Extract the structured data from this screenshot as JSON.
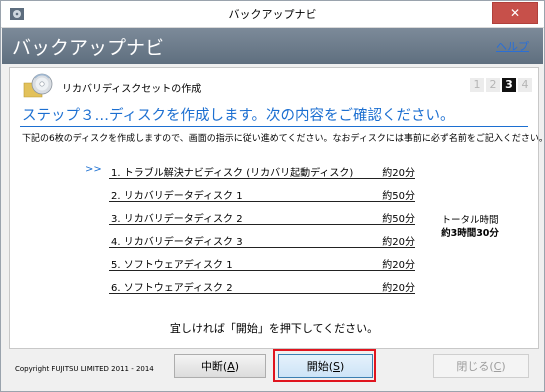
{
  "window": {
    "title": "バックアップナビ",
    "close_glyph": "✕"
  },
  "header": {
    "title": "バックアップナビ",
    "help_link": "ヘルプ"
  },
  "panel": {
    "section_label": "リカバリディスクセットの作成",
    "steps": [
      "1",
      "2",
      "3",
      "4"
    ],
    "current_step": 3,
    "heading": "ステップ３…ディスクを作成します。次の内容をご確認ください。",
    "instruction": "下記の6枚のディスクを作成しますので、画面の指示に従い進めてください。なおディスクには事前に必ず名前をご記入ください。",
    "current_marker": ">>",
    "discs": [
      {
        "name": "1. トラブル解決ナビディスク (リカバリ起動ディスク)",
        "time": "約20分"
      },
      {
        "name": "2. リカバリデータディスク 1",
        "time": "約50分"
      },
      {
        "name": "3. リカバリデータディスク 2",
        "time": "約50分"
      },
      {
        "name": "4. リカバリデータディスク 3",
        "time": "約20分"
      },
      {
        "name": "5. ソフトウェアディスク 1",
        "time": "約20分"
      },
      {
        "name": "6. ソフトウェアディスク 2",
        "time": "約20分"
      }
    ],
    "total_label": "トータル時間",
    "total_value": "約3時間30分",
    "confirm_text": "宜しければ「開始」を押下してください。"
  },
  "footer": {
    "copyright": "Copyright FUJITSU LIMITED 2011 - 2014",
    "pause_button": {
      "label": "中断(",
      "key": "A",
      "suffix": ")"
    },
    "start_button": {
      "label": "開始(",
      "key": "S",
      "suffix": ")"
    },
    "close_button": {
      "label": "閉じる(",
      "key": "C",
      "suffix": ")"
    }
  },
  "colors": {
    "accent": "#1c6fd1",
    "header_bg": "#6b7b8b",
    "highlight": "#e0141e",
    "close_button": "#c7504a"
  },
  "icons": [
    "app-icon",
    "close-icon",
    "disc-icon"
  ]
}
